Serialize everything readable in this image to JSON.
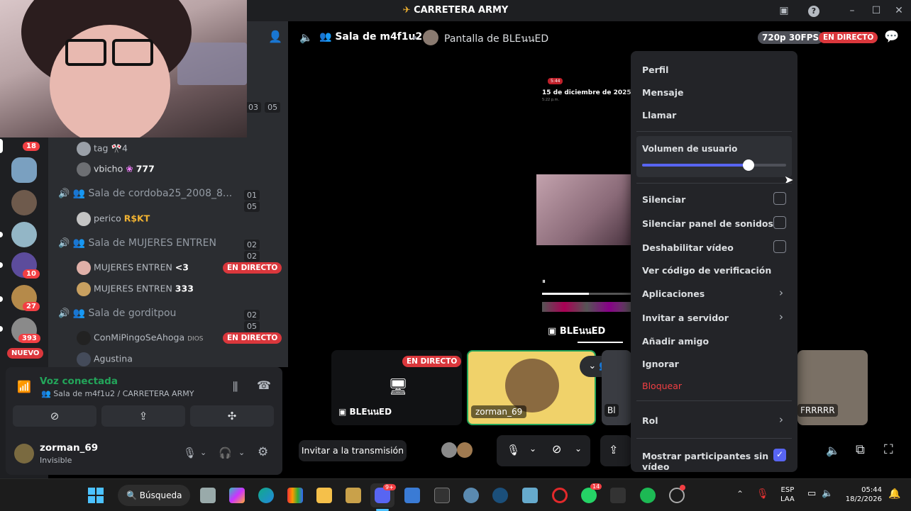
{
  "window": {
    "title": "CARRETERA ARMY",
    "controls": [
      "inbox-icon",
      "help-icon",
      "minimize-icon",
      "maximize-icon",
      "close-icon"
    ]
  },
  "rail": {
    "badges": [
      "18",
      "10",
      "27",
      "393"
    ],
    "new_label": "NUEVO"
  },
  "channels": {
    "partial_counts": [
      "03",
      "05"
    ],
    "partial_users": [
      {
        "name": "tag",
        "tag": "🎌4"
      },
      {
        "name": "vbicho",
        "tag": "777"
      }
    ],
    "voice_channels": [
      {
        "name": "Sala de cordoba25_2008_8...",
        "count_a": "01",
        "count_b": "05",
        "users": [
          {
            "name": "perico",
            "tag": "R$KT",
            "live": ""
          }
        ]
      },
      {
        "name": "Sala de MUJERES ENTREN",
        "count_a": "02",
        "count_b": "02",
        "users": [
          {
            "name": "MUJERES ENTREN",
            "tag": "<3",
            "live": "EN DIRECTO"
          },
          {
            "name": "MUJERES ENTREN",
            "tag": "333",
            "live": ""
          }
        ]
      },
      {
        "name": "Sala de gorditpou",
        "count_a": "02",
        "count_b": "05",
        "users": [
          {
            "name": "ConMiPingoSeAhoga",
            "tag": "DIOS",
            "live": "EN DIRECTO"
          },
          {
            "name": "Agustina",
            "tag": "",
            "live": ""
          }
        ]
      }
    ]
  },
  "voice_panel": {
    "status": "Voz conectada",
    "location": "Sala de m4f1u2 / CARRETERA ARMY"
  },
  "user_panel": {
    "username": "zorman_69",
    "status": "Invisible"
  },
  "stage": {
    "channel": "Sala de m4f1u2",
    "screen_label": "Pantalla de BLEนนED",
    "quality": "720p 30FPS",
    "live": "EN DIRECTO"
  },
  "phone_stream": {
    "time": "5:44",
    "date": "15 de diciembre de 2025",
    "sub": "5:22 p.m."
  },
  "tiles": {
    "tile1_live": "EN DIRECTO",
    "tile1_name": "BLEนนED",
    "tile2_name": "zorman_69",
    "tile3_name": "Bl",
    "tile4_name": "FRRRRR"
  },
  "controls": {
    "invite_label": "Invitar a la transmisión"
  },
  "context_menu": {
    "items_top": [
      "Perfil",
      "Mensaje",
      "Llamar"
    ],
    "volume_label": "Volumen de usuario",
    "volume_level": 0.74,
    "toggles": [
      {
        "label": "Silenciar",
        "checked": false
      },
      {
        "label": "Silenciar panel de sonidos",
        "checked": false
      },
      {
        "label": "Deshabilitar vídeo",
        "checked": false
      }
    ],
    "verify": "Ver código de verificación",
    "apps": "Aplicaciones",
    "invite": "Invitar a servidor",
    "add_friend": "Añadir amigo",
    "ignore": "Ignorar",
    "block": "Bloquear",
    "role": "Rol",
    "show_participants": "Mostrar participantes sin vídeo",
    "show_participants_checked": true,
    "block_color": "#f23f43",
    "accent": "#5865f2"
  },
  "taskbar": {
    "search": "Búsqueda",
    "lang_1": "ESP",
    "lang_2": "LAA",
    "time": "05:44",
    "date": "18/2/2026",
    "discord_badge": "9+",
    "whatsapp_badge": "14"
  }
}
